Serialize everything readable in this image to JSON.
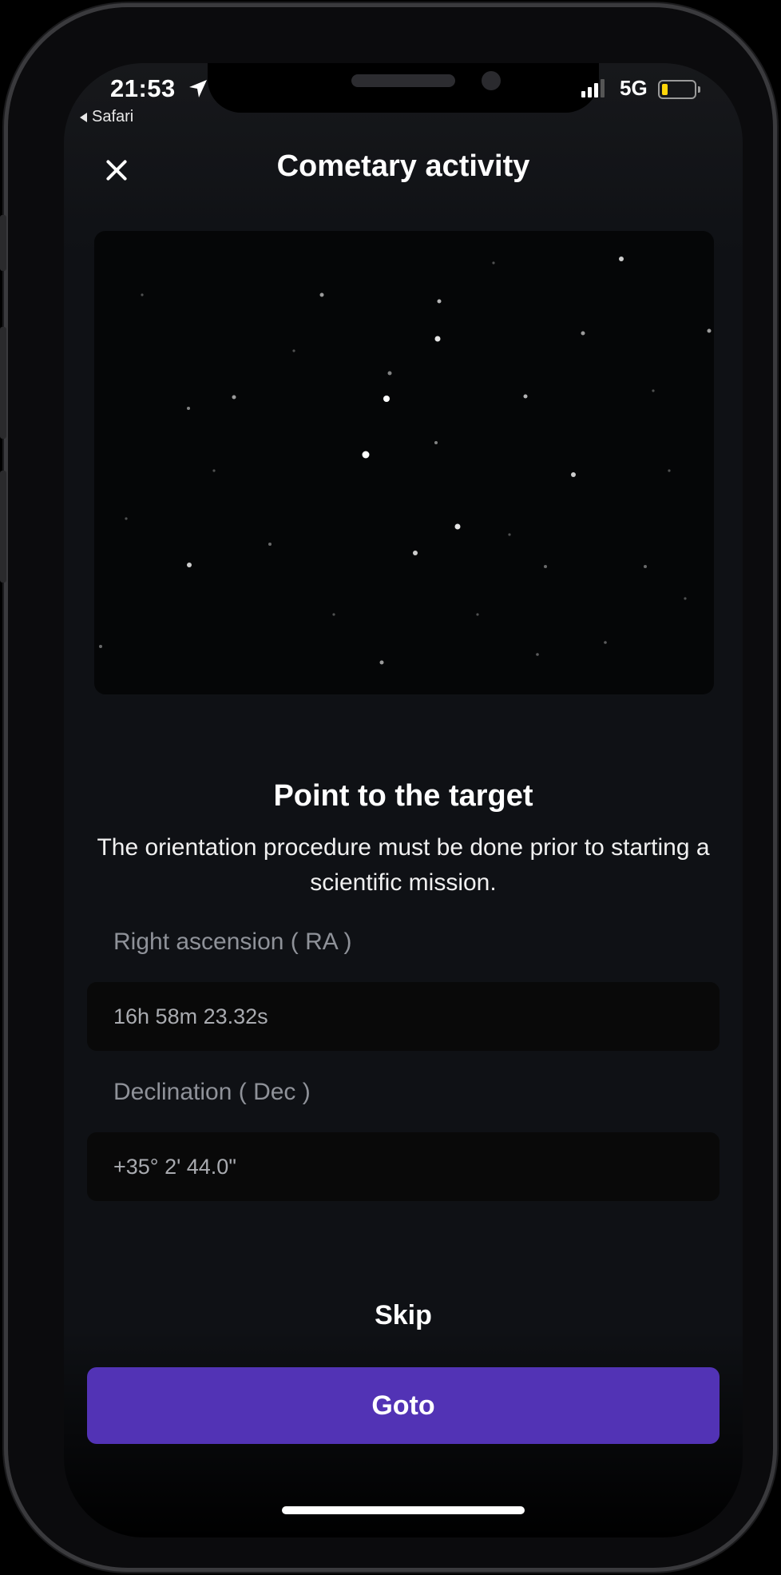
{
  "status_bar": {
    "time": "21:53",
    "back_app": "Safari",
    "network": "5G",
    "icons": [
      "location-arrow-icon",
      "signal-bars-icon",
      "battery-icon"
    ]
  },
  "header": {
    "title": "Cometary activity",
    "close_icon": "close-icon"
  },
  "sky_image": {
    "description_icon": "star-field-image"
  },
  "content": {
    "heading": "Point to the target",
    "description": "The orientation procedure must be done prior to starting a scientific mission."
  },
  "fields": {
    "ra_label": "Right ascension ( RA )",
    "ra_value": "16h 58m 23.32s",
    "dec_label": "Declination ( Dec )",
    "dec_value": "+35° 2' 44.0\""
  },
  "actions": {
    "skip_label": "Skip",
    "goto_label": "Goto"
  },
  "colors": {
    "background": "#0f1115",
    "button_primary": "#5233b5",
    "field_background": "#090909",
    "label_gray": "#8f9299",
    "battery_low": "#ffd60a"
  }
}
